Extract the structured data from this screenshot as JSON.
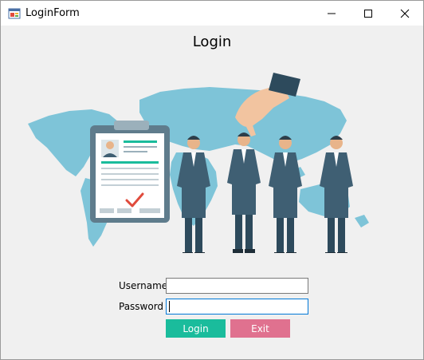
{
  "window": {
    "title": "LoginForm"
  },
  "form": {
    "heading": "Login",
    "username_label": "Username",
    "password_label": "Password",
    "username_value": "",
    "password_value": "",
    "login_button": "Login",
    "exit_button": "Exit"
  },
  "colors": {
    "login_button": "#1abc9c",
    "exit_button": "#e0718f",
    "map": "#7ec4d8",
    "suit": "#3f5f73",
    "form_background": "#f0f0f0"
  }
}
